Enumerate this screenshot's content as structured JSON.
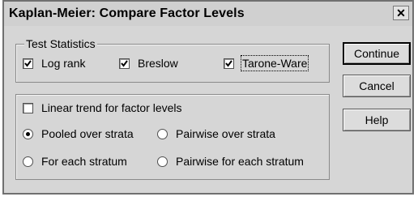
{
  "window": {
    "title": "Kaplan-Meier: Compare Factor Levels",
    "close_symbol": "✕"
  },
  "test_statistics": {
    "group_title": "Test Statistics",
    "options": [
      {
        "label": "Log rank",
        "checked": true
      },
      {
        "label": "Breslow",
        "checked": true
      },
      {
        "label": "Tarone-Ware",
        "checked": true
      }
    ]
  },
  "options": {
    "linear_trend": {
      "label": "Linear trend for factor levels",
      "checked": false
    },
    "radio_options": [
      {
        "label": "Pooled over strata",
        "selected": true
      },
      {
        "label": "Pairwise over strata",
        "selected": false
      },
      {
        "label": "For each stratum",
        "selected": false
      },
      {
        "label": "Pairwise for each stratum",
        "selected": false
      }
    ]
  },
  "buttons": {
    "continue": "Continue",
    "cancel": "Cancel",
    "help": "Help"
  }
}
